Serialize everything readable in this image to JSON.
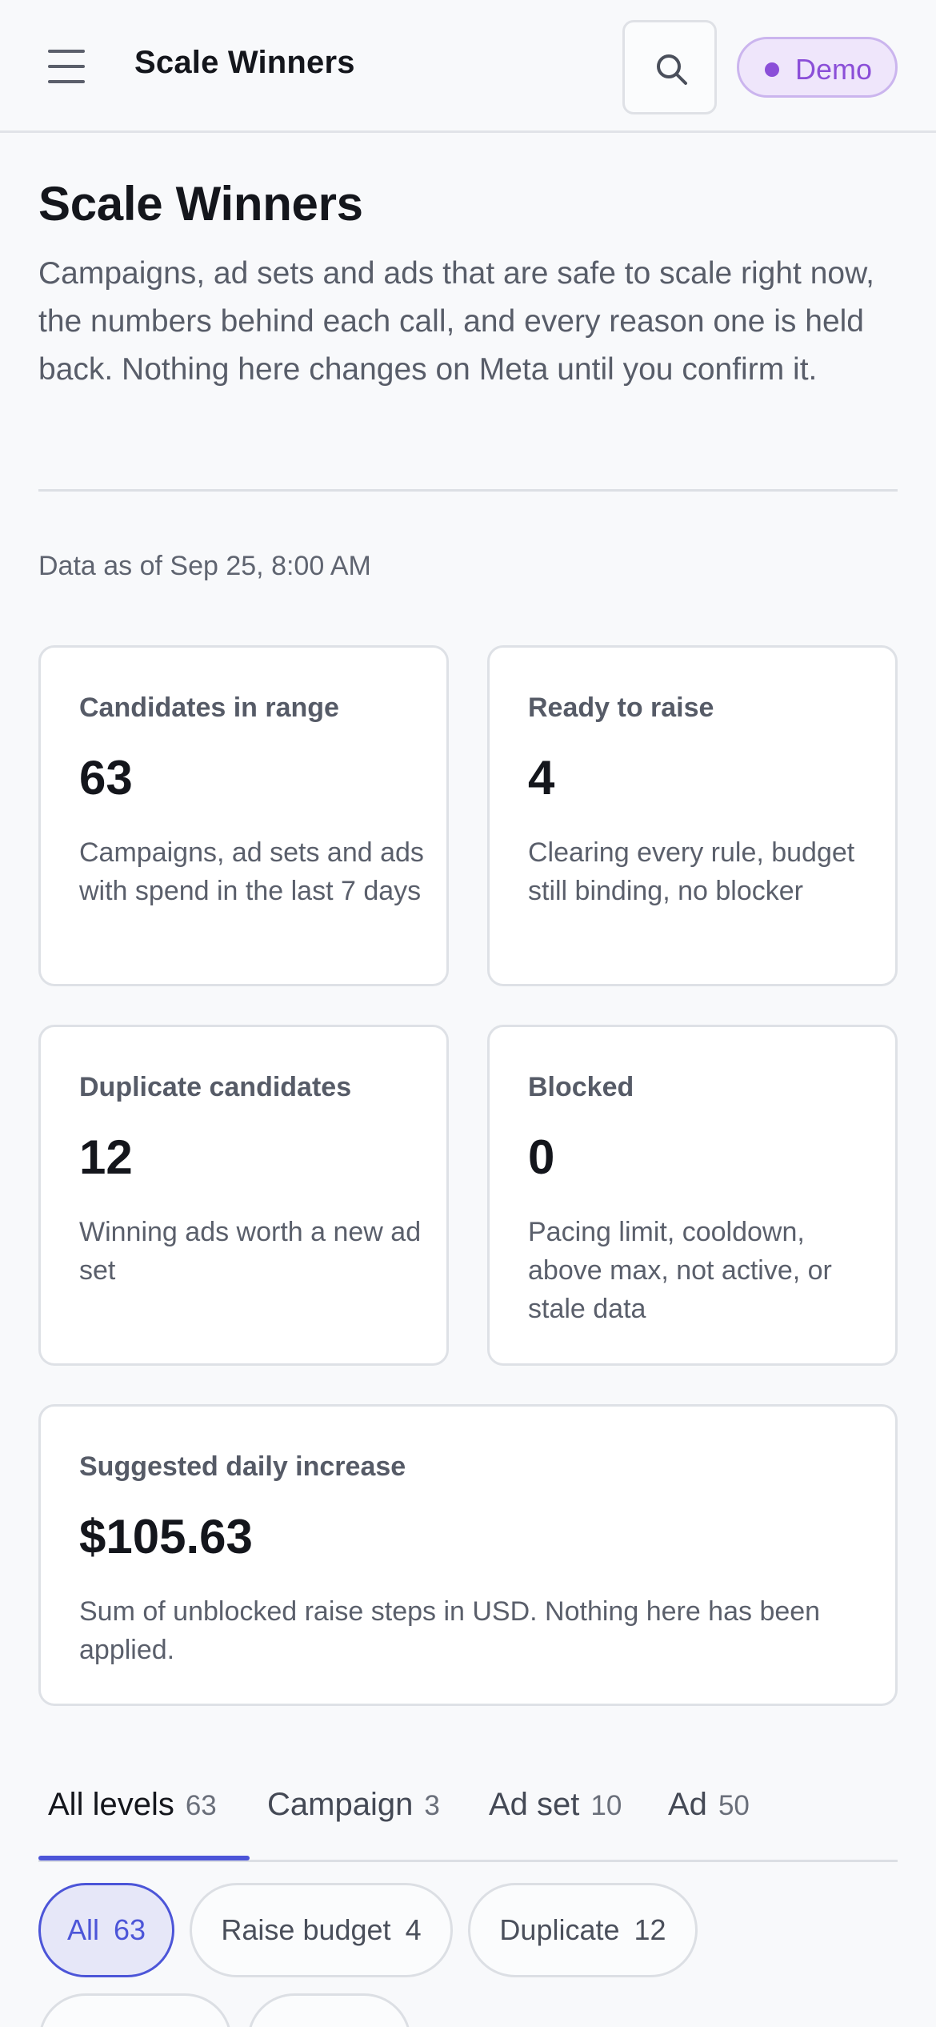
{
  "header": {
    "title": "Scale Winners",
    "badge": "Demo"
  },
  "intro": {
    "title": "Scale Winners",
    "description": "Campaigns, ad sets and ads that are safe to scale right now, the numbers behind each call, and every reason one is held back. Nothing here changes on Meta until you confirm it.",
    "data_as_of": "Data as of Sep 25, 8:00 AM"
  },
  "cards": {
    "candidates": {
      "label": "Candidates in range",
      "value": "63",
      "desc": "Campaigns, ad sets and ads with spend in the last 7 days"
    },
    "ready": {
      "label": "Ready to raise",
      "value": "4",
      "desc": "Clearing every rule, budget still binding, no blocker"
    },
    "duplicate": {
      "label": "Duplicate candidates",
      "value": "12",
      "desc": "Winning ads worth a new ad set"
    },
    "blocked": {
      "label": "Blocked",
      "value": "0",
      "desc": "Pacing limit, cooldown, above max, not active, or stale data"
    },
    "increase": {
      "label": "Suggested daily increase",
      "value": "$105.63",
      "desc": "Sum of unblocked raise steps in USD. Nothing here has been applied."
    }
  },
  "tabs": [
    {
      "label": "All levels",
      "count": "63"
    },
    {
      "label": "Campaign",
      "count": "3"
    },
    {
      "label": "Ad set",
      "count": "10"
    },
    {
      "label": "Ad",
      "count": "50"
    }
  ],
  "filters": [
    {
      "label": "All",
      "count": "63"
    },
    {
      "label": "Raise budget",
      "count": "4"
    },
    {
      "label": "Duplicate",
      "count": "12"
    }
  ],
  "colors": {
    "accent": "#4c55d8",
    "badge": "#8b4fd8"
  }
}
